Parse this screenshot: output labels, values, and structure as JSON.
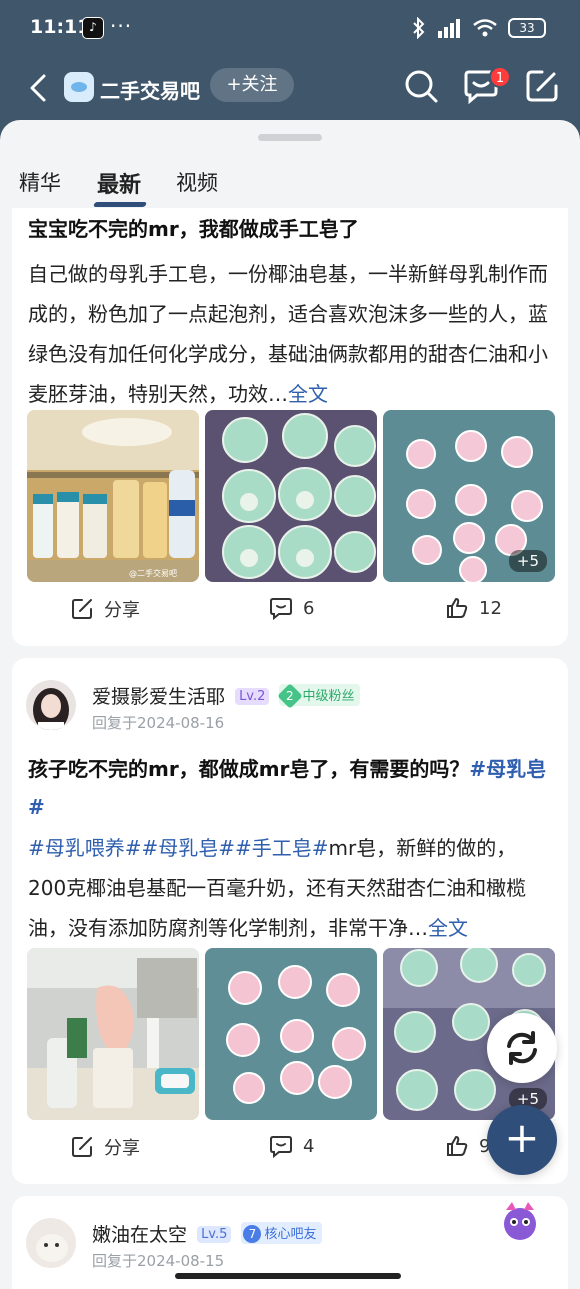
{
  "status": {
    "time": "11:11",
    "battery": "33",
    "dots": "···"
  },
  "header": {
    "forum_name": "二手交易吧",
    "follow_label": "+关注",
    "message_badge": "1"
  },
  "tabs": [
    {
      "label": "精华"
    },
    {
      "label": "最新"
    },
    {
      "label": "视频"
    }
  ],
  "posts": [
    {
      "title": "宝宝吃不完的mr，我都做成手工皂了",
      "body": "自己做的母乳手工皂，一份椰油皂基，一半新鲜母乳制作而成的，粉色加了一点起泡剂，适合喜欢泡沫多一些的人，蓝绿色没有加任何化学成分，基础油俩款都用的甜杏仁油和小麦胚芽油，特别天然，功效…",
      "more": "全文",
      "image_watermark": "@二手交易吧",
      "more_images": "+5",
      "share_label": "分享",
      "comments": "6",
      "likes": "12"
    },
    {
      "user": "爱摄影爱生活耶",
      "level": "Lv.2",
      "fan_level": "2",
      "fan_tag": "中级粉丝",
      "reply_date": "回复于2024-08-16",
      "title": "孩子吃不完的mr，都做成mr皂了，有需要的吗？",
      "title_tag": "#母乳皂#",
      "tags": "#母乳喂养##母乳皂##手工皂#",
      "body": "mr皂，新鲜的做的，200克椰油皂基配一百毫升奶，还有天然甜杏仁油和橄榄油，没有添加防腐剂等化学制剂，非常干净…",
      "more": "全文",
      "more_images": "+5",
      "share_label": "分享",
      "comments": "4",
      "likes": "9"
    },
    {
      "user": "嫩油在太空",
      "level": "Lv.5",
      "fan_level": "7",
      "fan_tag": "核心吧友",
      "reply_date": "回复于2024-08-15"
    }
  ],
  "icons": [
    "back-icon",
    "search-icon",
    "message-icon",
    "edit-icon",
    "share-icon",
    "comment-icon",
    "like-icon",
    "refresh-icon",
    "add-icon"
  ]
}
